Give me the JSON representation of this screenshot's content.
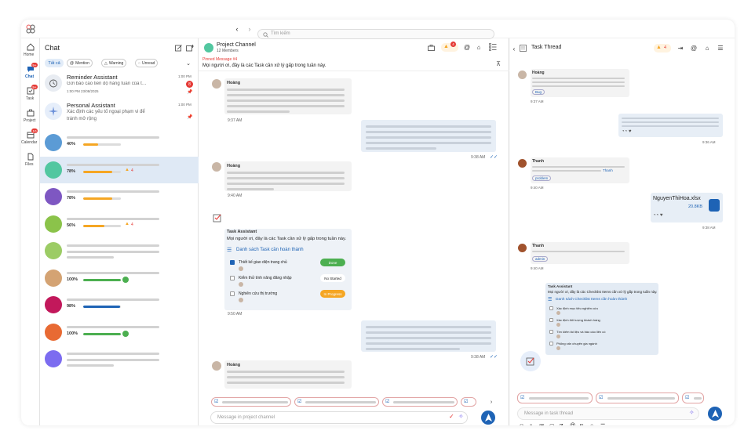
{
  "topbar": {
    "search_placeholder": "Tìm kiếm"
  },
  "rail": {
    "items": [
      "Home",
      "Chat",
      "Task",
      "Project",
      "Calendar",
      "Files"
    ],
    "badges": {
      "chat": "9+",
      "task": "9+",
      "calendar": "10"
    }
  },
  "chat_list": {
    "title": "Chat",
    "filters": [
      "Tất cả",
      "Mention",
      "Warning",
      "Unread"
    ],
    "reminder": {
      "name": "Reminder Assistant",
      "preview": "Gửi báo cáo tiến độ hàng tuần của t…",
      "time": "1:00 PM",
      "meta": "1:00 PM 23/08/2025",
      "badge": "8"
    },
    "personal": {
      "name": "Personal Assistant",
      "preview1": "Xác định các yếu tố ngoại phạm vi để",
      "preview2": "tránh mở rộng",
      "time": "1:00 PM"
    },
    "rows": [
      {
        "percent": "40%",
        "progress": 0.4,
        "color": "#f5a623",
        "avatar": "#5b9bd5"
      },
      {
        "percent": "78%",
        "progress": 0.78,
        "color": "#f5a623",
        "avatar": "#52c7a0",
        "warn": "4"
      },
      {
        "percent": "78%",
        "progress": 0.78,
        "color": "#f5a623",
        "avatar": "#7e57c2"
      },
      {
        "percent": "56%",
        "progress": 0.56,
        "color": "#f5a623",
        "avatar": "#8bc34a",
        "warn": "4"
      },
      {
        "percent": "",
        "progress": 0,
        "color": "#f5a623",
        "avatar": "#9ccc65"
      },
      {
        "percent": "100%",
        "progress": 1.0,
        "color": "#4caf50",
        "avatar": "#d4a373"
      },
      {
        "percent": "98%",
        "progress": 0.98,
        "color": "#1e63b5",
        "avatar": "#c2185b"
      },
      {
        "percent": "100%",
        "progress": 1.0,
        "color": "#4caf50",
        "avatar": "#e86a33"
      },
      {
        "percent": "",
        "progress": 0,
        "color": "#4caf50",
        "avatar": "#7c6cf0"
      }
    ]
  },
  "channel": {
    "name": "Project Channel",
    "members": "12 Members",
    "pinned_label": "Pinned Message #4",
    "pinned_text": "Mọi người ơi, đây là các Task cần xử lý gấp trong tuần này.",
    "badge": "4",
    "msgs": {
      "hoang": "Hoàng",
      "t1": "9:37 AM",
      "t2": "9:38 AM",
      "t3": "9:40 AM",
      "t4": "9:50 AM",
      "t5": "9:38 AM"
    },
    "task": {
      "sender": "Task Assistant",
      "text": "Mọi người ơi, đây là các Task cần xử lý gấp trong tuần này.",
      "list_title": "Danh sách Task cần hoàn thành",
      "items": [
        {
          "label": "Thiết kế giao diện trang chủ",
          "status": "Done",
          "color": "#4caf50",
          "checked": true
        },
        {
          "label": "Kiểm thử tính năng đăng nhập",
          "status": "No Started",
          "color": "#ffffff",
          "checked": false
        },
        {
          "label": "Nghiên cứu thị trường",
          "status": "In Progress",
          "color": "#f5a623",
          "checked": false
        }
      ]
    },
    "input_placeholder": "Message in project channel"
  },
  "thread": {
    "title": "Task Thread",
    "badge": "4",
    "hoang": "Hoàng",
    "bug": "Bug",
    "thanh": "Thanh",
    "mention": "Thanh",
    "problem": "problem",
    "admin": "admin",
    "file_name": "NguyenThiHoa.xlsx",
    "file_size": "20.8KB",
    "times": {
      "a": "9:37 AM",
      "b": "9:36 AM",
      "c": "9:40 AM",
      "d": "9:38 AM",
      "e": "9:40 AM"
    },
    "task": {
      "sender": "Task Assistant",
      "text": "Mọi người ơi, đây là các Checklist Items cần xử lý gấp trong tuần này.",
      "list_title": "Danh sách Checklist Items cần hoàn thành",
      "items": [
        "Xác định mục tiêu nghiên cứu",
        "Xác định đối tượng khách hàng",
        "Tìm kiếm tài liệu và báo cáo liên có",
        "Phỏng vấn chuyên gia ngành"
      ]
    },
    "input_placeholder": "Message in task thread"
  }
}
